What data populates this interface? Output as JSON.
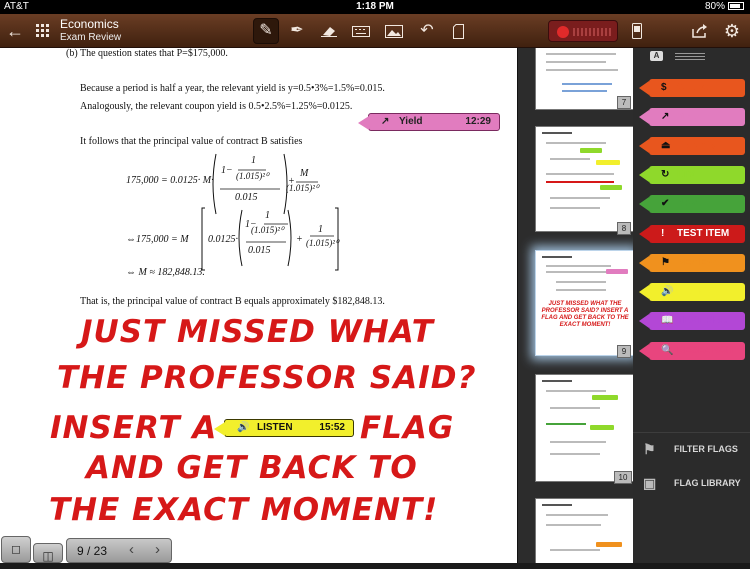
{
  "status": {
    "carrier": "AT&T",
    "time": "1:18 PM",
    "battery": "80%"
  },
  "toolbar": {
    "title": "Economics",
    "subtitle": "Exam Review",
    "icons": [
      "back-arrow-icon",
      "grid-icon",
      "pen-icon",
      "highlighter-icon",
      "eraser-icon",
      "keyboard-icon",
      "image-icon",
      "undo-icon",
      "page-icon",
      "record-icon",
      "phone-icon",
      "share-icon",
      "gear-icon"
    ]
  },
  "document": {
    "lines": {
      "l1": "(b) The question states that P=$175,000.",
      "l2": "Because a period is half a year, the relevant yield is y=0.5•3%=1.5%=0.015.",
      "l3": "Analogously, the relevant coupon yield is 0.5•2.5%=1.25%=0.0125.",
      "l4": "It follows that the principal value of contract B satisfies",
      "eq1a": "175,000 = 0.0125· M·",
      "eq1b": "1−",
      "eq1c": "1",
      "eq1d": "(1.015)²⁰",
      "eq1e": "0.015",
      "eq1f": "+",
      "eq1g": "M",
      "eq1h": "(1.015)²⁰",
      "eq2a": "⇔175,000 = M",
      "eq2b": "0.0125·",
      "eq2c": "1−",
      "eq2d": "1",
      "eq2e": "(1.015)²⁰",
      "eq2f": "0.015",
      "eq2g": "+",
      "eq2h": "1",
      "eq2i": "(1.015)²⁰",
      "eq3": "⇔ M ≈ 182,848.13.",
      "l5": "That is, the principal value of contract B equals approximately $182,848.13."
    },
    "flags": {
      "yield": {
        "label": "Yield",
        "time": "12:29",
        "icon": "chart-icon"
      },
      "listen": {
        "label": "LISTEN",
        "time": "15:52",
        "icon": "speaker-icon"
      }
    },
    "handwriting": {
      "h1": "JUST MISSED WHAT",
      "h2": "THE PROFESSOR SAID?",
      "h3a": "INSERT A",
      "h3b": "FLAG",
      "h4": "AND GET BACK TO",
      "h5": "THE EXACT MOMENT!"
    }
  },
  "thumbnails": {
    "p7": "7",
    "p8": "8",
    "p9": "9",
    "p9_note": "JUST MISSED WHAT THE PROFESSOR SAID? INSERT A FLAG AND GET BACK TO THE EXACT MOMENT!",
    "p10": "10"
  },
  "flag_types": [
    {
      "label": "Coupon",
      "icon": "$",
      "color": "#e8561e"
    },
    {
      "label": "Yield",
      "icon": "↗",
      "color": "#e17cbf"
    },
    {
      "label": "Maturity",
      "icon": "⏏",
      "color": "#e8561e"
    },
    {
      "label": "LTV",
      "icon": "↻",
      "color": "#8fd92b"
    },
    {
      "label": "NPV",
      "icon": "✔",
      "color": "#46a33a"
    },
    {
      "label": "TEST ITEM",
      "icon": "!",
      "color": "#cc1a1a"
    },
    {
      "label": "REVIEW",
      "icon": "⚑",
      "color": "#f0911e"
    },
    {
      "label": "LISTEN",
      "icon": "🔊",
      "color": "#f2ef2c"
    },
    {
      "label": "TEXT REF.",
      "icon": "📖",
      "color": "#b347d6"
    },
    {
      "label": "RESEARCH",
      "icon": "🔍",
      "color": "#e8457e"
    }
  ],
  "panel": {
    "a_label": "A",
    "filter_flags": "FILTER FLAGS",
    "flag_library": "FLAG LIBRARY"
  },
  "pager": {
    "label": "9 / 23"
  }
}
